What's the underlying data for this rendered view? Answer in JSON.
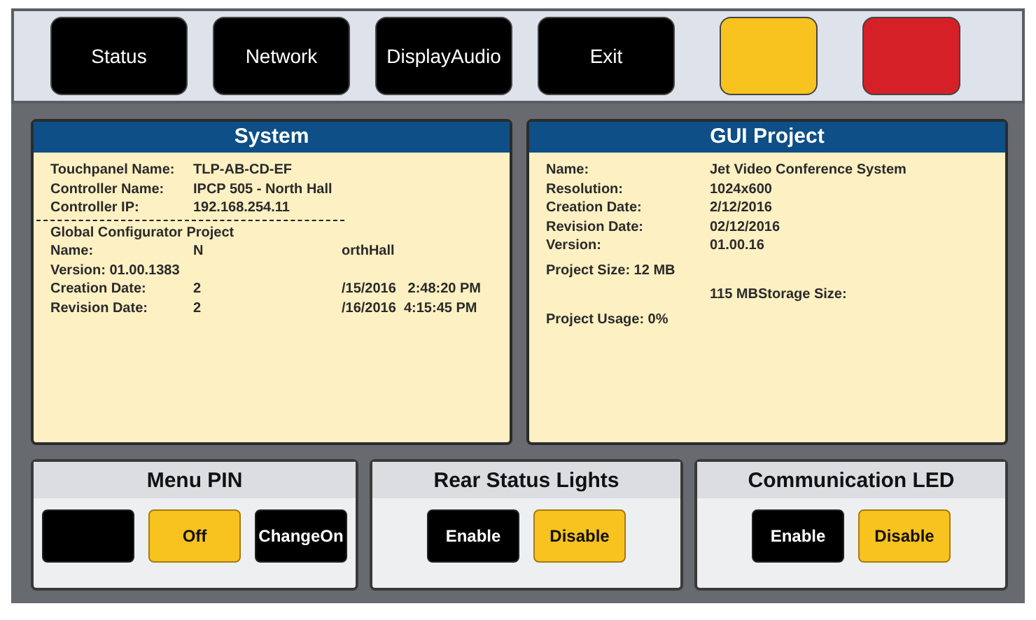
{
  "top_bar": {
    "buttons": [
      {
        "label": "Status",
        "color": "#000000"
      },
      {
        "label": "Network",
        "color": "#000000"
      },
      {
        "label": "DisplayAudio",
        "color": "#000000"
      },
      {
        "label": "Exit",
        "color": "#000000"
      },
      {
        "color": "#f9c31f"
      },
      {
        "color": "#d62027"
      }
    ]
  },
  "panels": [
    {
      "title": "System",
      "rows": [
        {
          "kind": "pair",
          "label": "Touchpanel Name:",
          "value": "TLP-AB-CD-EF"
        },
        {
          "kind": "pair",
          "label": "Controller Name:",
          "value": "IPCP 505 - North Hall"
        },
        {
          "kind": "pair",
          "label": "Controller IP:",
          "value": "192.168.254.11"
        },
        {
          "kind": "divider"
        },
        {
          "kind": "wide",
          "label": "Global Configurator Project"
        },
        {
          "kind": "triple",
          "label": "Name:",
          "value": "N",
          "value_3": "orthHall"
        },
        {
          "kind": "wide",
          "label": "Version: 01.00.1383"
        },
        {
          "kind": "triple",
          "label": "Creation Date:",
          "value": "2",
          "value_3": "/15/2016   2:48:20 PM"
        },
        {
          "kind": "triple",
          "label": "Revision Date:",
          "value": "2",
          "value_3": "/16/2016  4:15:45 PM"
        }
      ]
    },
    {
      "title": "GUI Project",
      "rows": [
        {
          "kind": "pair",
          "label": "Name:",
          "value": "Jet Video Conference System"
        },
        {
          "kind": "pair",
          "label": "Resolution:",
          "value": "1024x600"
        },
        {
          "kind": "pair",
          "label": "Creation Date:",
          "value": "2/12/2016"
        },
        {
          "kind": "pair",
          "label": "Revision Date:",
          "value": "02/12/2016"
        },
        {
          "kind": "pair",
          "label": "Version:",
          "value": "01.00.16"
        },
        {
          "kind": "wide",
          "label": "Project Size: 12 MB"
        },
        {
          "kind": "value_only",
          "value": "115 MBStorage Size:"
        },
        {
          "kind": "wide",
          "label": "Project Usage: 0%"
        }
      ]
    }
  ],
  "settings": [
    {
      "title": "Menu PIN",
      "buttons": [
        {
          "selected": false
        },
        {
          "label": "Off",
          "selected": true
        },
        {
          "label": "ChangeOn",
          "selected": false
        }
      ]
    },
    {
      "title": "Rear Status Lights",
      "buttons": [
        {
          "label": "Enable",
          "selected": false
        },
        {
          "label": "Disable",
          "selected": true
        }
      ]
    },
    {
      "title": "Communication LED",
      "buttons": [
        {
          "label": "Enable",
          "selected": false
        },
        {
          "label": "Disable",
          "selected": true
        }
      ]
    }
  ]
}
